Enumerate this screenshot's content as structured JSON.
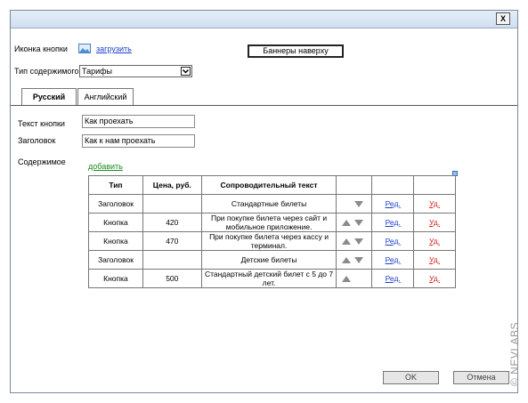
{
  "window": {
    "close_label": "X"
  },
  "form": {
    "icon_label": "Иконка кнопки",
    "upload_link": "загрузить",
    "banner_button": "Баннеры наверху",
    "content_type_label": "Тип содержимого",
    "content_type_value": "Тарифы",
    "button_text_label": "Текст кнопки",
    "button_text_value": "Как проехать",
    "heading_label": "Заголовок",
    "heading_value": "Как к нам проехать",
    "content_label": "Содержимое",
    "add_link": "добавить"
  },
  "tabs": [
    {
      "label": "Русский",
      "active": true
    },
    {
      "label": "Английский",
      "active": false
    }
  ],
  "table": {
    "headers": [
      "Тип",
      "Цена, руб.",
      "Сопроводительный текст",
      "",
      "",
      ""
    ],
    "rows": [
      {
        "type": "Заголовок",
        "price": "",
        "text": "Стандартные билеты",
        "up": false,
        "down": true,
        "edit": "Ред.",
        "delete": "Уд."
      },
      {
        "type": "Кнопка",
        "price": "420",
        "text": "При покупке билета через сайт и мобильное приложение.",
        "up": true,
        "down": true,
        "edit": "Ред.",
        "delete": "Уд."
      },
      {
        "type": "Кнопка",
        "price": "470",
        "text": "При покупке билета через кассу и терминал.",
        "up": true,
        "down": true,
        "edit": "Ред.",
        "delete": "Уд."
      },
      {
        "type": "Заголовок",
        "price": "",
        "text": "Детские билеты",
        "up": true,
        "down": true,
        "edit": "Ред.",
        "delete": "Уд."
      },
      {
        "type": "Кнопка",
        "price": "500",
        "text": "Стандартный детский билет с 5 до 7 лет.",
        "up": true,
        "down": false,
        "edit": "Ред.",
        "delete": "Уд."
      }
    ]
  },
  "watermark": "© NEVLABS",
  "footer": {
    "ok_label": "OK",
    "cancel_label": "Отмена"
  }
}
